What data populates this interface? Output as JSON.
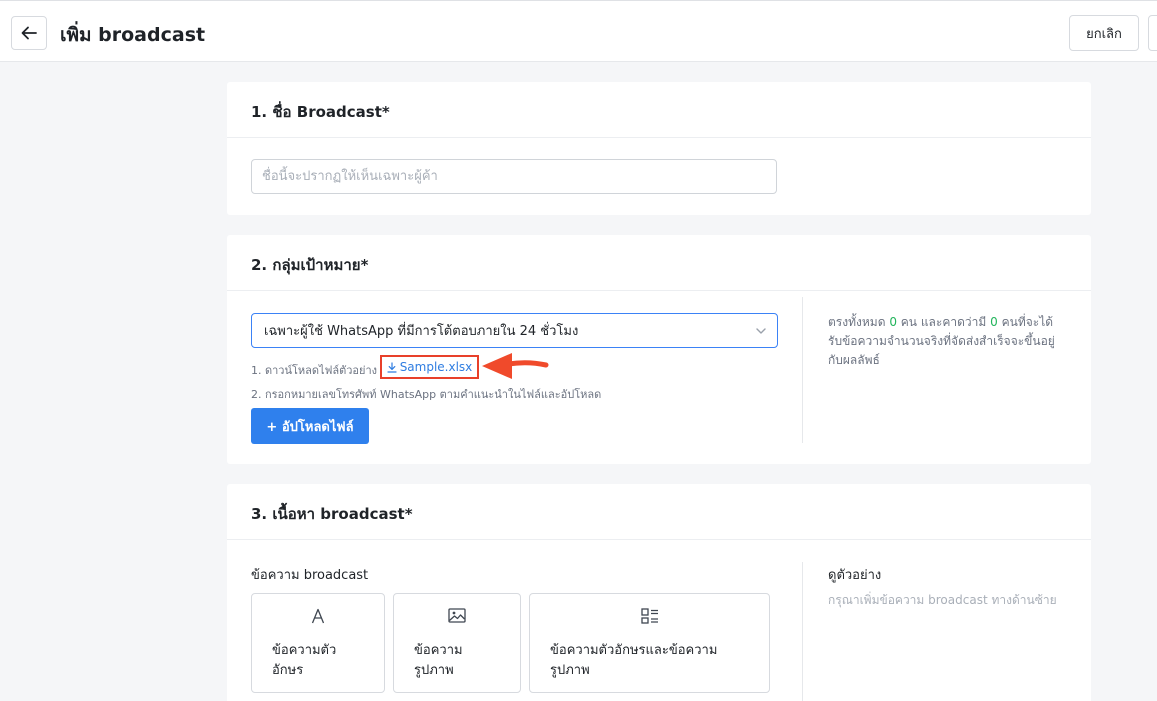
{
  "header": {
    "title": "เพิ่ม broadcast",
    "cancel_label": "ยกเลิก"
  },
  "section1": {
    "title": "1. ชื่อ Broadcast*",
    "name_placeholder": "ชื่อนี้จะปรากฏให้เห็นเฉพาะผู้ค้า",
    "name_value": ""
  },
  "section2": {
    "title": "2. กลุ่มเป้าหมาย*",
    "selected_audience": "เฉพาะผู้ใช้ WhatsApp ที่มีการโต้ตอบภายใน 24 ชั่วโมง",
    "step1_text": "1. ดาวน์โหลดไฟล์ตัวอย่าง",
    "sample_file": "Sample.xlsx",
    "step2_text": "2. กรอกหมายเลขโทรศัพท์ WhatsApp ตามคำแนะนำในไฟล์และอัปโหลด",
    "upload_label": "+ อัปโหลดไฟล์",
    "summary_prefix": "ตรงทั้งหมด",
    "total_count": "0",
    "summary_mid": "คน และคาดว่ามี",
    "expected_count": "0",
    "summary_suffix": "คนที่จะได้รับข้อความจำนวนจริงที่จัดส่งสำเร็จจะขึ้นอยู่กับผลลัพธ์"
  },
  "section3": {
    "title": "3. เนื้อหา broadcast*",
    "message_label": "ข้อความ broadcast",
    "types": [
      {
        "label": "ข้อความตัวอักษร",
        "icon": "text-icon"
      },
      {
        "label": "ข้อความรูปภาพ",
        "icon": "image-icon"
      },
      {
        "label": "ข้อความตัวอักษรและข้อความรูปภาพ",
        "icon": "text-image-icon"
      }
    ],
    "preview_title": "ดูตัวอย่าง",
    "preview_hint": "กรุณาเพิ่มข้อความ broadcast ทางด้านซ้าย"
  },
  "colors": {
    "primary": "#2f80ed",
    "highlight_border": "#e8402a",
    "count_green": "#22b45b"
  }
}
